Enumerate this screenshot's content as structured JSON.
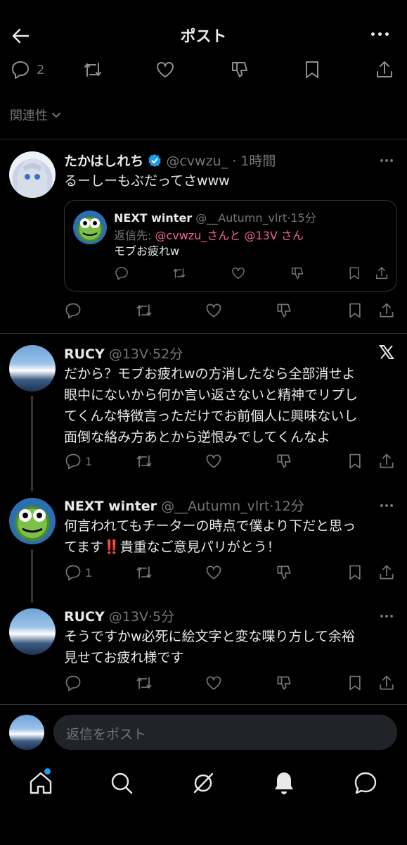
{
  "header": {
    "title": "ポスト"
  },
  "topbar": {
    "reply_count": "2"
  },
  "sort": {
    "label": "関連性"
  },
  "posts": [
    {
      "name": "たかはしれち",
      "verified": true,
      "handle": "@cvwzu_",
      "time": "1時間",
      "text": "るーしーもぶだってさwww",
      "quote": {
        "name": "NEXT winter",
        "handle": "@__Autumn_vlrt",
        "time": "15分",
        "reply_prefix": "返信先:",
        "reply_targets": "@cvwzu_さんと @13V さん",
        "text": "モブお疲れw"
      }
    },
    {
      "name": "RUCY",
      "handle": "@13V",
      "time": "52分",
      "lines": [
        "だから？モブお疲れwの方消したなら全部消せよ",
        "眼中にないから何か言い返さないと精神でリプし",
        "てくんな特徴言っただけでお前個人に興味ないし",
        "面倒な絡み方あとから逆恨みでしてくんなよ"
      ],
      "reply_count": "1",
      "source_icon": "x-logo-icon"
    },
    {
      "name": "NEXT winter",
      "handle": "@__Autumn_vlrt",
      "time": "12分",
      "lines": [
        "何言われてもチーターの時点で僕より下だと思っ",
        "てます‼️貴重なご意見パリがとう！"
      ],
      "reply_count": "1"
    },
    {
      "name": "RUCY",
      "handle": "@13V",
      "time": "5分",
      "lines": [
        "そうですかw必死に絵文字と変な喋り方して余裕",
        "見せてお疲れ様です"
      ]
    }
  ],
  "reply_bar": {
    "placeholder": "返信をポスト"
  },
  "nav": [
    "home-icon",
    "search-icon",
    "grok-icon",
    "notifications-icon",
    "messages-icon"
  ],
  "colors": {
    "background": "#000000",
    "text": "#e7e9ea",
    "muted": "#71767b",
    "accent": "#1d9bf0",
    "mention": "#f0629a"
  }
}
